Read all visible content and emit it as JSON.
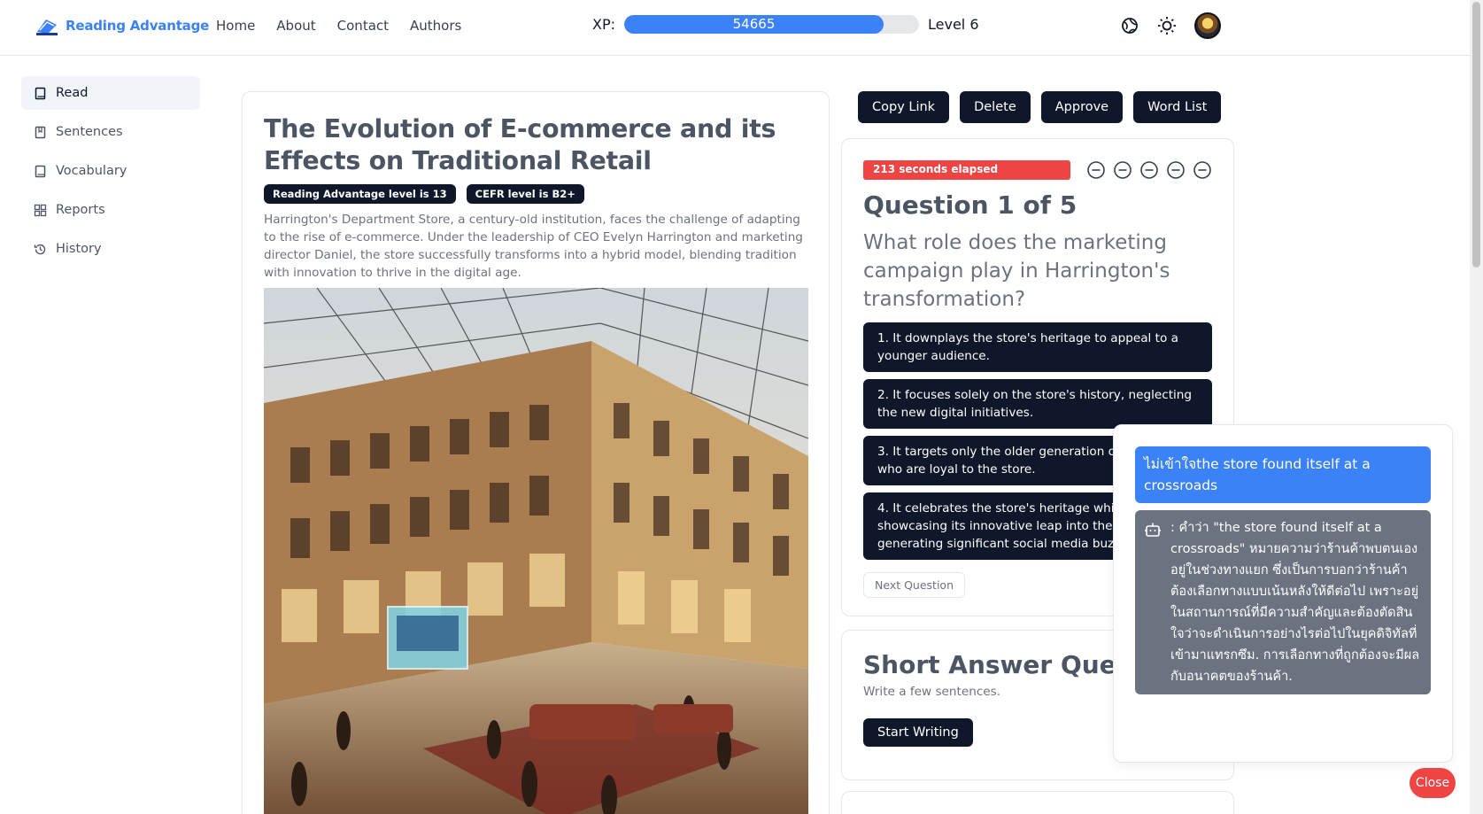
{
  "header": {
    "brand": "Reading Advantage",
    "nav": [
      "Home",
      "About",
      "Contact",
      "Authors"
    ],
    "xp_label": "XP:",
    "xp_value": "54665",
    "xp_progress": 0.88,
    "level": "Level 6",
    "icons": [
      "theme-toggle-icon",
      "sun-icon",
      "user-avatar"
    ]
  },
  "sidebar": {
    "items": [
      {
        "label": "Read",
        "icon": "book-icon",
        "active": true
      },
      {
        "label": "Sentences",
        "icon": "bookmark-book-icon"
      },
      {
        "label": "Vocabulary",
        "icon": "book-icon"
      },
      {
        "label": "Reports",
        "icon": "grid-icon"
      },
      {
        "label": "History",
        "icon": "history-icon"
      }
    ]
  },
  "article": {
    "title": "The Evolution of E-commerce and its Effects on Traditional Retail",
    "badge_level": "Reading Advantage level is 13",
    "badge_cefr": "CEFR level is B2+",
    "summary": "Harrington's Department Store, a century-old institution, faces the challenge of adapting to the rise of e-commerce. Under the leadership of CEO Evelyn Harrington and marketing director Daniel, the store successfully transforms into a hybrid model, blending tradition with innovation to thrive in the digital age."
  },
  "actions": {
    "copy_link": "Copy Link",
    "delete": "Delete",
    "approve": "Approve",
    "word_list": "Word List"
  },
  "quiz": {
    "timer": "213 seconds elapsed",
    "title": "Question 1 of 5",
    "question": "What role does the marketing campaign play in Harrington's transformation?",
    "options": [
      "1. It downplays the store's heritage to appeal to a younger audience.",
      "2. It focuses solely on the store's history, neglecting the new digital initiatives.",
      "3. It targets only the older generation of customers who are loyal to the store.",
      "4. It celebrates the store's heritage while showcasing its innovative leap into the future, generating significant social media buzz."
    ],
    "next": "Next Question"
  },
  "short_answer": {
    "title": "Short Answer Question",
    "subtitle": "Write a few sentences.",
    "button": "Start Writing"
  },
  "chat": {
    "user_message": "ไม่เข้าใจthe store found itself at a crossroads",
    "bot_message": ": คำว่า \"the store found itself at a crossroads\" หมายความว่าร้านค้าพบตนเองอยู่ในช่วงทางแยก ซึ่งเป็นการบอกว่าร้านค้าต้องเลือกทางแบบเน้นหลังให้ดีต่อไป เพราะอยู่ในสถานการณ์ที่มีความสำคัญและต้องตัดสินใจว่าจะดำเนินการอย่างไรต่อไปในยุคดิจิทัลที่เข้ามาแทรกซึม. การเลือกทางที่ถูกต้องจะมีผลกับอนาคตของร้านค้า.",
    "close": "Close"
  },
  "colors": {
    "primary": "#3b82f6",
    "dark": "#0f172a",
    "danger": "#ef4444",
    "muted": "#6b7280"
  }
}
